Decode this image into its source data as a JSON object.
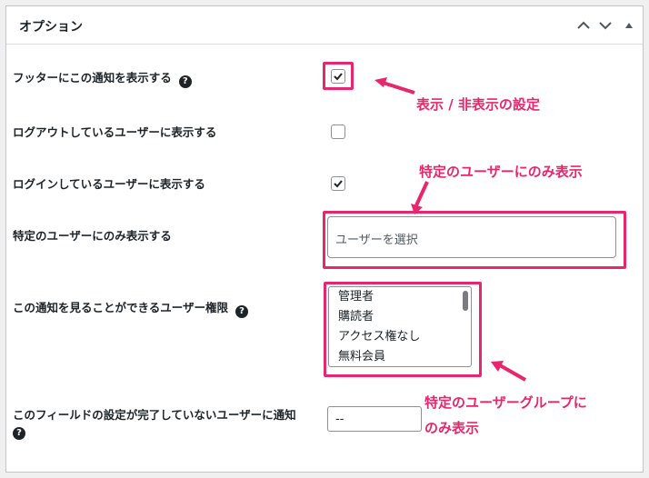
{
  "panel": {
    "title": "オプション",
    "controls": [
      "chevron-up-icon",
      "chevron-down-icon",
      "triangle-up-icon"
    ]
  },
  "rows": [
    {
      "label": "フッターにこの通知を表示する",
      "help": "?",
      "checked": true
    },
    {
      "label": "ログアウトしているユーザーに表示する",
      "checked": false
    },
    {
      "label": "ログインしているユーザーに表示する",
      "checked": true
    },
    {
      "label": "特定のユーザーにのみ表示する"
    },
    {
      "label": "この通知を見ることができるユーザー権限",
      "help": "?"
    },
    {
      "label": "このフィールドの設定が完了していないユーザーに通知",
      "help": "?"
    }
  ],
  "user_select": {
    "placeholder": "ユーザーを選択"
  },
  "roles_list": [
    "管理者",
    "購読者",
    "アクセス権なし",
    "無料会員"
  ],
  "notify_dropdown": {
    "value": "--"
  },
  "annotations": {
    "show_hide": "表示 / 非表示の設定",
    "specific_user": "特定のユーザーにのみ表示",
    "group_line1": "特定のユーザーグループに",
    "group_line2": "のみ表示"
  },
  "colors": {
    "accent": "#e8266d",
    "border": "#8c8f94",
    "text": "#1d2327"
  }
}
